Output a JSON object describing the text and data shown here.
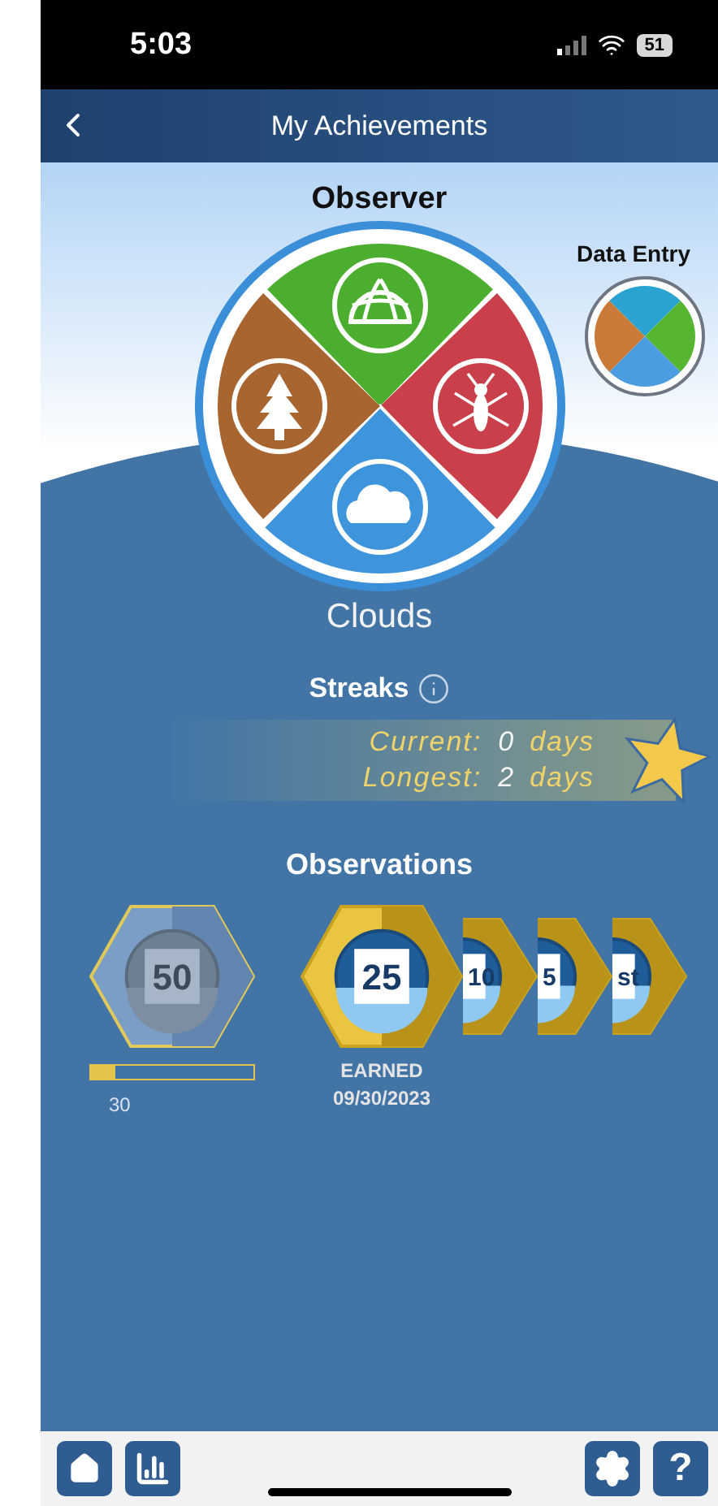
{
  "status_bar": {
    "time": "5:03",
    "battery": "51"
  },
  "header": {
    "title": "My Achievements"
  },
  "wheel": {
    "title": "Observer",
    "selected_label": "Clouds",
    "quadrants": [
      {
        "kind": "landcover",
        "color": "#4cae2e",
        "selected": false
      },
      {
        "kind": "mosquito",
        "color": "#c9404a",
        "selected": false
      },
      {
        "kind": "clouds",
        "color": "#3f95dc",
        "selected": true
      },
      {
        "kind": "trees",
        "color": "#a86530",
        "selected": false
      }
    ]
  },
  "data_entry": {
    "label": "Data Entry"
  },
  "streaks": {
    "title": "Streaks",
    "rows": [
      {
        "label": "Current:",
        "value": "0",
        "unit": "days"
      },
      {
        "label": "Longest:",
        "value": "2",
        "unit": "days"
      }
    ]
  },
  "observations": {
    "title": "Observations",
    "next": {
      "number": "50",
      "level": 0.15,
      "count": "30"
    },
    "badges": [
      {
        "number": "25",
        "earned": true,
        "status": "EARNED",
        "date": "09/30/2023"
      },
      {
        "number": "10",
        "earned": true
      },
      {
        "number": "5",
        "earned": true
      },
      {
        "number": "st",
        "earned": true
      }
    ]
  },
  "tab_bar": {
    "help": "?"
  }
}
